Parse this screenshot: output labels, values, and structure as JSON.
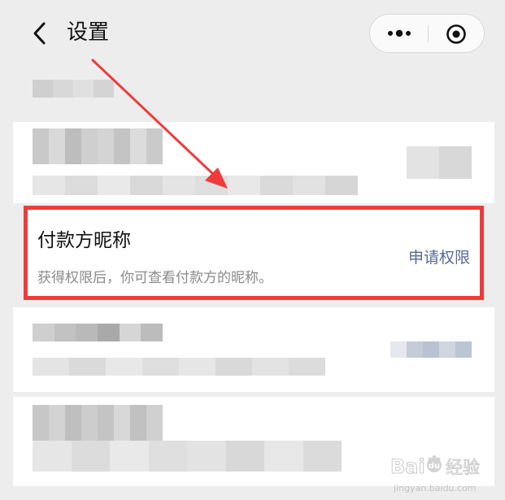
{
  "nav": {
    "title": "设置",
    "back_icon": "chevron-left-icon",
    "more_icon": "more-dots-icon",
    "close_icon": "target-close-icon"
  },
  "highlighted_setting": {
    "title": "付款方昵称",
    "description": "获得权限后，你可查看付款方的昵称。",
    "action": "申请权限"
  },
  "colors": {
    "page_background": "#ededed",
    "highlight_border": "#ee3b3b",
    "annotation_arrow": "#ee3b3b",
    "link": "#576b95"
  },
  "watermark": {
    "brand": "Baidu经验",
    "url": "jingyan.baidu.com"
  }
}
